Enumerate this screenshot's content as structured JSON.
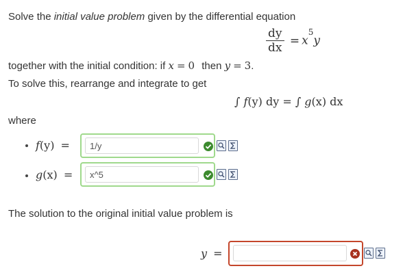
{
  "intro": {
    "text1": "Solve the ",
    "emph": "initial value problem",
    "text2": " given by the differential equation"
  },
  "equation": {
    "num": "dy",
    "den": "dx",
    "rhs_eq": "=",
    "rhs_x": "x",
    "rhs_exp": "5",
    "rhs_y": "y"
  },
  "condition": {
    "text1": "together with the initial condition: if ",
    "var_x": "x",
    "eq1": "=",
    "x_val": "0",
    "then": "then ",
    "var_y": "y",
    "eq2": "=",
    "y_val": "3",
    "end": "."
  },
  "rearrange": "To solve this, rearrange and integrate to get",
  "integral": {
    "int1": "∫",
    "f": "f",
    "fy_arg": "(y)",
    "d1": "dy",
    "eq": "=",
    "int2": "∫",
    "g": "g",
    "gx_arg": "(x)",
    "d2": "dx"
  },
  "where": "where",
  "answers": [
    {
      "label_fn": "f",
      "label_arg": "(y)",
      "label_eq": "=",
      "value": "1/y",
      "status": "correct"
    },
    {
      "label_fn": "g",
      "label_arg": "(x)",
      "label_eq": "=",
      "value": "x^5",
      "status": "correct"
    }
  ],
  "solution_prompt": "The solution to the original initial value problem is",
  "final": {
    "label_var": "y",
    "label_eq": "=",
    "value": "",
    "status": "incorrect"
  },
  "colors": {
    "correct_border": "#9fd98c",
    "correct_mark": "#3c8a2e",
    "incorrect_border": "#c4462b",
    "incorrect_mark": "#a8321f"
  },
  "icons": [
    "check-icon",
    "preview-icon",
    "equation-editor-icon",
    "error-icon"
  ]
}
